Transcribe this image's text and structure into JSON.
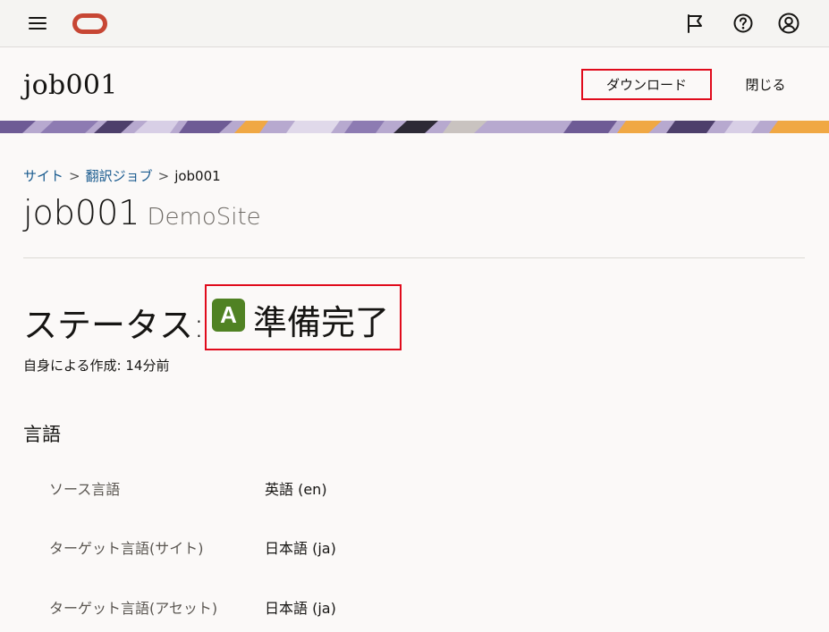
{
  "header": {
    "title": "job001",
    "download_label": "ダウンロード",
    "close_label": "閉じる"
  },
  "breadcrumb": {
    "items": [
      "サイト",
      "翻訳ジョブ",
      "job001"
    ],
    "separator": ">"
  },
  "page": {
    "title": "job001",
    "subtitle": "DemoSite"
  },
  "status": {
    "label": "ステータス:",
    "badge": "A",
    "value": "準備完了",
    "badge_color": "#508223"
  },
  "created_text": "自身による作成: 14分前",
  "languages": {
    "heading": "言語",
    "rows": [
      {
        "label": "ソース言語",
        "value": "英語 (en)"
      },
      {
        "label": "ターゲット言語(サイト)",
        "value": "日本語 (ja)"
      },
      {
        "label": "ターゲット言語(アセット)",
        "value": "日本語 (ja)"
      }
    ]
  },
  "icons": {
    "menu": "hamburger-menu-icon",
    "logo": "oracle-logo",
    "flag": "flag-icon",
    "help": "help-icon",
    "user": "user-avatar-icon"
  },
  "colors": {
    "accent_red": "#c74634",
    "highlight_border": "#e00b1c",
    "link": "#1a5b8f"
  }
}
